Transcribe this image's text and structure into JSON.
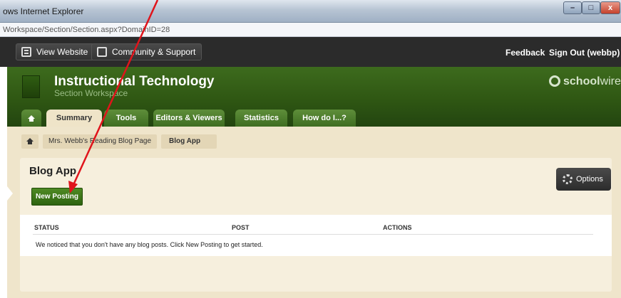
{
  "window": {
    "title": "ows Internet Explorer",
    "url": "Workspace/Section/Section.aspx?DomainID=28",
    "min_glyph": "–",
    "max_glyph": "□",
    "close_glyph": "x"
  },
  "topnav": {
    "view_website": "View Website",
    "community": "Community & Support",
    "feedback": "Feedback",
    "signout": "Sign Out (webbp)"
  },
  "header": {
    "title": "Instructional Technology",
    "subtitle": "Section Workspace",
    "brand_bold": "school",
    "brand_light": "wires"
  },
  "tabs": [
    {
      "label": "Summary"
    },
    {
      "label": "Tools"
    },
    {
      "label": "Editors & Viewers"
    },
    {
      "label": "Statistics"
    },
    {
      "label": "How do I...?"
    }
  ],
  "breadcrumb": {
    "page": "Mrs. Webb's Reading Blog Page",
    "app": "Blog App"
  },
  "panel": {
    "title": "Blog App",
    "new_posting": "New Posting",
    "options": "Options"
  },
  "table": {
    "columns": [
      "STATUS",
      "POST",
      "ACTIONS"
    ],
    "empty_message": "We noticed that you don't have any blog posts. Click New Posting to get started."
  },
  "colors": {
    "header_green": "#2f5713",
    "tan_background": "#efe5cb",
    "annotation_red": "#e0141b"
  }
}
